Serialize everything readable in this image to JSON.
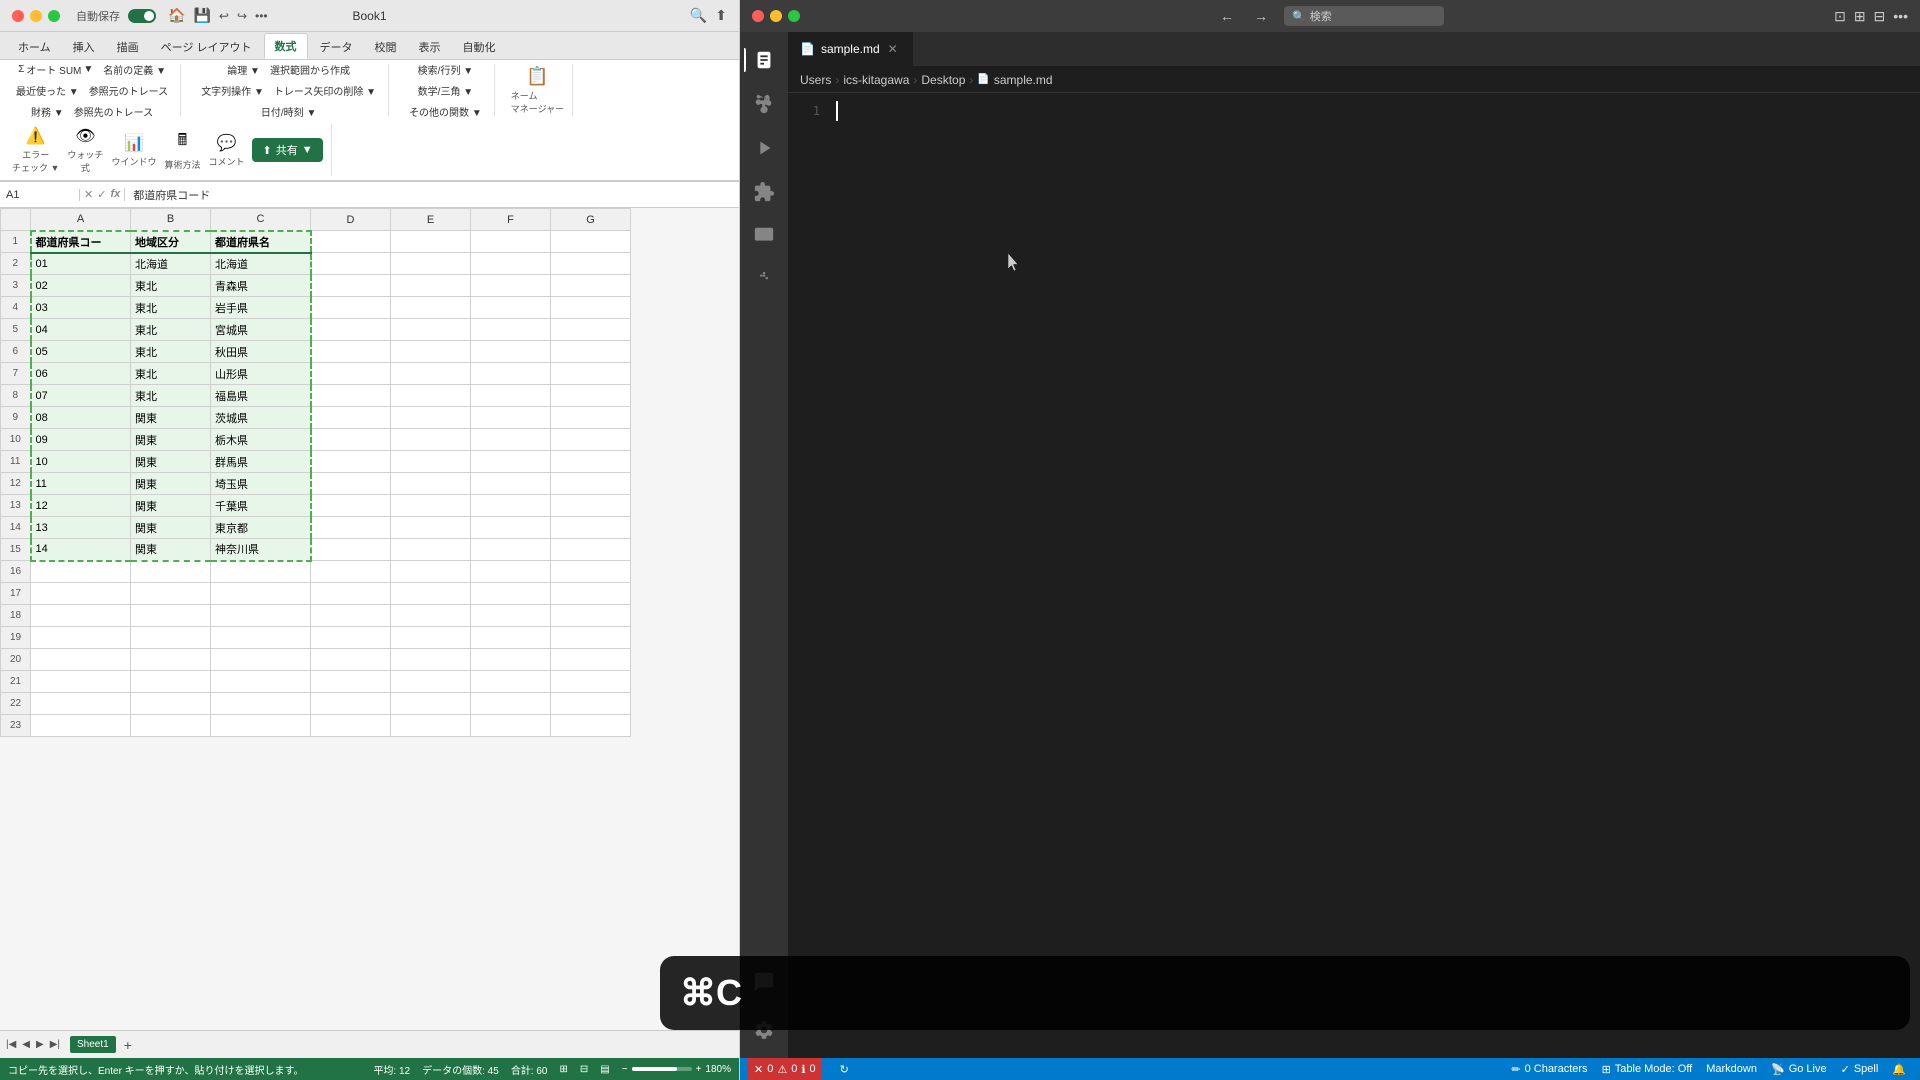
{
  "excel": {
    "titlebar": {
      "title": "Book1",
      "autosave_label": "自動保存",
      "buttons": [
        "戻る",
        "進む"
      ]
    },
    "ribbon": {
      "tabs": [
        "ホーム",
        "挿入",
        "描画",
        "ページ レイアウト",
        "数式",
        "データ",
        "校閲",
        "表示",
        "自動化"
      ],
      "active_tab": "数式",
      "groups": {
        "function_library": {
          "buttons": [
            "オート SUM ▼",
            "最近使った▼",
            "財務 ▼"
          ],
          "buttons2": [
            "論理 ▼",
            "文字列操作 ▼",
            "日付/時刻 ▼"
          ],
          "buttons3": [
            "検索/行列 ▼",
            "数学/三角 ▼",
            "その他の関数 ▼"
          ]
        }
      }
    },
    "formula_bar": {
      "cell_ref": "A1",
      "formula": "都道府県コード"
    },
    "columns": [
      "",
      "A",
      "B",
      "C",
      "D",
      "E",
      "F",
      "G"
    ],
    "col_headers": [
      "都道府県コー",
      "地域区分",
      "都道府県名"
    ],
    "rows": [
      {
        "num": 1,
        "a": "都道府県コー",
        "b": "地域区分",
        "c": "都道府県名"
      },
      {
        "num": 2,
        "a": "01",
        "b": "北海道",
        "c": "北海道"
      },
      {
        "num": 3,
        "a": "02",
        "b": "東北",
        "c": "青森県"
      },
      {
        "num": 4,
        "a": "03",
        "b": "東北",
        "c": "岩手県"
      },
      {
        "num": 5,
        "a": "04",
        "b": "東北",
        "c": "宮城県"
      },
      {
        "num": 6,
        "a": "05",
        "b": "東北",
        "c": "秋田県"
      },
      {
        "num": 7,
        "a": "06",
        "b": "東北",
        "c": "山形県"
      },
      {
        "num": 8,
        "a": "07",
        "b": "東北",
        "c": "福島県"
      },
      {
        "num": 9,
        "a": "08",
        "b": "関東",
        "c": "茨城県"
      },
      {
        "num": 10,
        "a": "09",
        "b": "関東",
        "c": "栃木県"
      },
      {
        "num": 11,
        "a": "10",
        "b": "関東",
        "c": "群馬県"
      },
      {
        "num": 12,
        "a": "11",
        "b": "関東",
        "c": "埼玉県"
      },
      {
        "num": 13,
        "a": "12",
        "b": "関東",
        "c": "千葉県"
      },
      {
        "num": 14,
        "a": "13",
        "b": "関東",
        "c": "東京都"
      },
      {
        "num": 15,
        "a": "14",
        "b": "関東",
        "c": "神奈川県"
      },
      {
        "num": 16,
        "a": "",
        "b": "",
        "c": ""
      },
      {
        "num": 17,
        "a": "",
        "b": "",
        "c": ""
      },
      {
        "num": 18,
        "a": "",
        "b": "",
        "c": ""
      },
      {
        "num": 19,
        "a": "",
        "b": "",
        "c": ""
      },
      {
        "num": 20,
        "a": "",
        "b": "",
        "c": ""
      },
      {
        "num": 21,
        "a": "",
        "b": "",
        "c": ""
      },
      {
        "num": 22,
        "a": "",
        "b": "",
        "c": ""
      },
      {
        "num": 23,
        "a": "",
        "b": "",
        "c": ""
      }
    ],
    "sheet_tabs": [
      "Sheet1"
    ],
    "status": {
      "message": "コピー先を選択し、Enter キーを押すか、貼り付けを選択します。",
      "avg": "平均: 12",
      "data_count": "データの個数: 45",
      "sum": "合計: 60",
      "zoom": "180%"
    }
  },
  "keyboard_shortcut": {
    "symbol": "⌘C"
  },
  "vscode": {
    "titlebar": {
      "back_label": "←",
      "forward_label": "→",
      "search_placeholder": "検索"
    },
    "tab": {
      "filename": "sample.md",
      "modified": false
    },
    "breadcrumb": {
      "parts": [
        "Users",
        "ics-kitagawa",
        "Desktop",
        "sample.md"
      ]
    },
    "editor": {
      "line_numbers": [
        1
      ],
      "content": ""
    },
    "status_bar": {
      "errors": "0",
      "warnings": "0",
      "info": "0",
      "sync_icon": "↻",
      "characters_count": "0 Characters",
      "table_mode": "Table Mode: Off",
      "language": "Markdown",
      "go_live": "Go Live",
      "spell": "Spell"
    }
  }
}
